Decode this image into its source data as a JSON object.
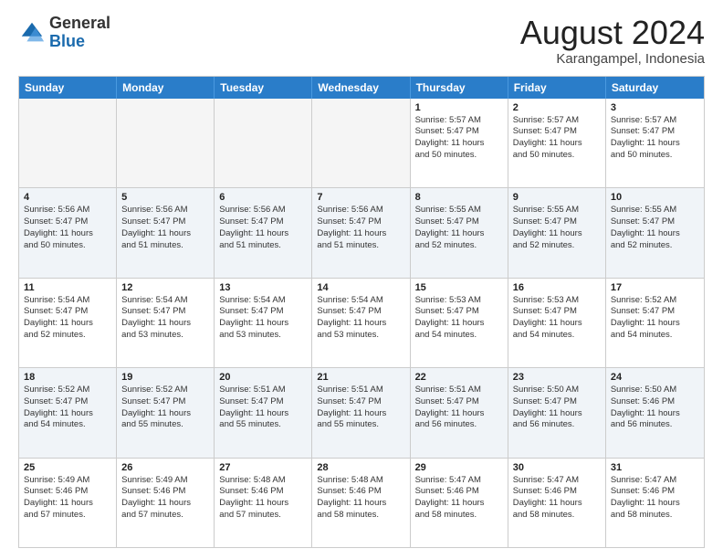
{
  "header": {
    "logo_general": "General",
    "logo_blue": "Blue",
    "month_year": "August 2024",
    "location": "Karangampel, Indonesia"
  },
  "calendar": {
    "days_of_week": [
      "Sunday",
      "Monday",
      "Tuesday",
      "Wednesday",
      "Thursday",
      "Friday",
      "Saturday"
    ],
    "rows": [
      [
        {
          "day": "",
          "info": "",
          "empty": true
        },
        {
          "day": "",
          "info": "",
          "empty": true
        },
        {
          "day": "",
          "info": "",
          "empty": true
        },
        {
          "day": "",
          "info": "",
          "empty": true
        },
        {
          "day": "1",
          "info": "Sunrise: 5:57 AM\nSunset: 5:47 PM\nDaylight: 11 hours\nand 50 minutes."
        },
        {
          "day": "2",
          "info": "Sunrise: 5:57 AM\nSunset: 5:47 PM\nDaylight: 11 hours\nand 50 minutes."
        },
        {
          "day": "3",
          "info": "Sunrise: 5:57 AM\nSunset: 5:47 PM\nDaylight: 11 hours\nand 50 minutes."
        }
      ],
      [
        {
          "day": "4",
          "info": "Sunrise: 5:56 AM\nSunset: 5:47 PM\nDaylight: 11 hours\nand 50 minutes."
        },
        {
          "day": "5",
          "info": "Sunrise: 5:56 AM\nSunset: 5:47 PM\nDaylight: 11 hours\nand 51 minutes."
        },
        {
          "day": "6",
          "info": "Sunrise: 5:56 AM\nSunset: 5:47 PM\nDaylight: 11 hours\nand 51 minutes."
        },
        {
          "day": "7",
          "info": "Sunrise: 5:56 AM\nSunset: 5:47 PM\nDaylight: 11 hours\nand 51 minutes."
        },
        {
          "day": "8",
          "info": "Sunrise: 5:55 AM\nSunset: 5:47 PM\nDaylight: 11 hours\nand 52 minutes."
        },
        {
          "day": "9",
          "info": "Sunrise: 5:55 AM\nSunset: 5:47 PM\nDaylight: 11 hours\nand 52 minutes."
        },
        {
          "day": "10",
          "info": "Sunrise: 5:55 AM\nSunset: 5:47 PM\nDaylight: 11 hours\nand 52 minutes."
        }
      ],
      [
        {
          "day": "11",
          "info": "Sunrise: 5:54 AM\nSunset: 5:47 PM\nDaylight: 11 hours\nand 52 minutes."
        },
        {
          "day": "12",
          "info": "Sunrise: 5:54 AM\nSunset: 5:47 PM\nDaylight: 11 hours\nand 53 minutes."
        },
        {
          "day": "13",
          "info": "Sunrise: 5:54 AM\nSunset: 5:47 PM\nDaylight: 11 hours\nand 53 minutes."
        },
        {
          "day": "14",
          "info": "Sunrise: 5:54 AM\nSunset: 5:47 PM\nDaylight: 11 hours\nand 53 minutes."
        },
        {
          "day": "15",
          "info": "Sunrise: 5:53 AM\nSunset: 5:47 PM\nDaylight: 11 hours\nand 54 minutes."
        },
        {
          "day": "16",
          "info": "Sunrise: 5:53 AM\nSunset: 5:47 PM\nDaylight: 11 hours\nand 54 minutes."
        },
        {
          "day": "17",
          "info": "Sunrise: 5:52 AM\nSunset: 5:47 PM\nDaylight: 11 hours\nand 54 minutes."
        }
      ],
      [
        {
          "day": "18",
          "info": "Sunrise: 5:52 AM\nSunset: 5:47 PM\nDaylight: 11 hours\nand 54 minutes."
        },
        {
          "day": "19",
          "info": "Sunrise: 5:52 AM\nSunset: 5:47 PM\nDaylight: 11 hours\nand 55 minutes."
        },
        {
          "day": "20",
          "info": "Sunrise: 5:51 AM\nSunset: 5:47 PM\nDaylight: 11 hours\nand 55 minutes."
        },
        {
          "day": "21",
          "info": "Sunrise: 5:51 AM\nSunset: 5:47 PM\nDaylight: 11 hours\nand 55 minutes."
        },
        {
          "day": "22",
          "info": "Sunrise: 5:51 AM\nSunset: 5:47 PM\nDaylight: 11 hours\nand 56 minutes."
        },
        {
          "day": "23",
          "info": "Sunrise: 5:50 AM\nSunset: 5:47 PM\nDaylight: 11 hours\nand 56 minutes."
        },
        {
          "day": "24",
          "info": "Sunrise: 5:50 AM\nSunset: 5:46 PM\nDaylight: 11 hours\nand 56 minutes."
        }
      ],
      [
        {
          "day": "25",
          "info": "Sunrise: 5:49 AM\nSunset: 5:46 PM\nDaylight: 11 hours\nand 57 minutes."
        },
        {
          "day": "26",
          "info": "Sunrise: 5:49 AM\nSunset: 5:46 PM\nDaylight: 11 hours\nand 57 minutes."
        },
        {
          "day": "27",
          "info": "Sunrise: 5:48 AM\nSunset: 5:46 PM\nDaylight: 11 hours\nand 57 minutes."
        },
        {
          "day": "28",
          "info": "Sunrise: 5:48 AM\nSunset: 5:46 PM\nDaylight: 11 hours\nand 58 minutes."
        },
        {
          "day": "29",
          "info": "Sunrise: 5:47 AM\nSunset: 5:46 PM\nDaylight: 11 hours\nand 58 minutes."
        },
        {
          "day": "30",
          "info": "Sunrise: 5:47 AM\nSunset: 5:46 PM\nDaylight: 11 hours\nand 58 minutes."
        },
        {
          "day": "31",
          "info": "Sunrise: 5:47 AM\nSunset: 5:46 PM\nDaylight: 11 hours\nand 58 minutes."
        }
      ]
    ]
  }
}
